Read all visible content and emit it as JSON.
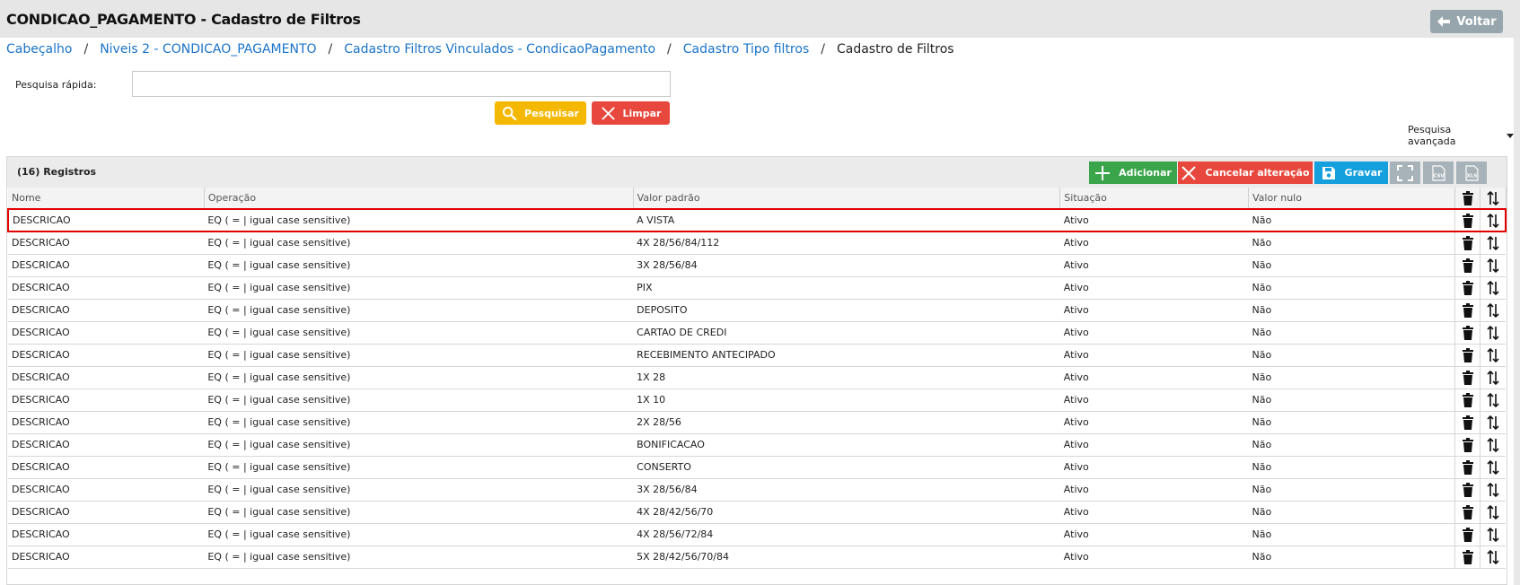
{
  "header": {
    "title": "CONDICAO_PAGAMENTO - Cadastro de Filtros",
    "back_label": "Voltar"
  },
  "breadcrumb": {
    "items": [
      "Cabeçalho",
      "Niveis 2 - CONDICAO_PAGAMENTO",
      "Cadastro Filtros Vinculados - CondicaoPagamento",
      "Cadastro Tipo filtros"
    ],
    "current": "Cadastro de Filtros",
    "separator": "/"
  },
  "search": {
    "label": "Pesquisa rápida:",
    "value": "",
    "search_label": "Pesquisar",
    "clear_label": "Limpar",
    "advanced_label": "Pesquisa avançada"
  },
  "panel": {
    "count_label": "(16) Registros",
    "add_label": "Adicionar",
    "cancel_label": "Cancelar alteração",
    "save_label": "Gravar",
    "csv_label": "CSV",
    "xls_label": "XLS"
  },
  "table": {
    "columns": [
      "Nome",
      "Operação",
      "Valor padrão",
      "Situação",
      "Valor nulo"
    ],
    "rows": [
      [
        "DESCRICAO",
        "EQ ( = | igual case sensitive)",
        "A VISTA",
        "Ativo",
        "Não"
      ],
      [
        "DESCRICAO",
        "EQ ( = | igual case sensitive)",
        "4X 28/56/84/112",
        "Ativo",
        "Não"
      ],
      [
        "DESCRICAO",
        "EQ ( = | igual case sensitive)",
        "3X 28/56/84",
        "Ativo",
        "Não"
      ],
      [
        "DESCRICAO",
        "EQ ( = | igual case sensitive)",
        "PIX",
        "Ativo",
        "Não"
      ],
      [
        "DESCRICAO",
        "EQ ( = | igual case sensitive)",
        "DEPOSITO",
        "Ativo",
        "Não"
      ],
      [
        "DESCRICAO",
        "EQ ( = | igual case sensitive)",
        "CARTAO DE CREDI",
        "Ativo",
        "Não"
      ],
      [
        "DESCRICAO",
        "EQ ( = | igual case sensitive)",
        "RECEBIMENTO ANTECIPADO",
        "Ativo",
        "Não"
      ],
      [
        "DESCRICAO",
        "EQ ( = | igual case sensitive)",
        "1X 28",
        "Ativo",
        "Não"
      ],
      [
        "DESCRICAO",
        "EQ ( = | igual case sensitive)",
        "1X 10",
        "Ativo",
        "Não"
      ],
      [
        "DESCRICAO",
        "EQ ( = | igual case sensitive)",
        "2X 28/56",
        "Ativo",
        "Não"
      ],
      [
        "DESCRICAO",
        "EQ ( = | igual case sensitive)",
        "BONIFICACAO",
        "Ativo",
        "Não"
      ],
      [
        "DESCRICAO",
        "EQ ( = | igual case sensitive)",
        "CONSERTO",
        "Ativo",
        "Não"
      ],
      [
        "DESCRICAO",
        "EQ ( = | igual case sensitive)",
        "3X 28/56/84",
        "Ativo",
        "Não"
      ],
      [
        "DESCRICAO",
        "EQ ( = | igual case sensitive)",
        "4X 28/42/56/70",
        "Ativo",
        "Não"
      ],
      [
        "DESCRICAO",
        "EQ ( = | igual case sensitive)",
        "4X 28/56/72/84",
        "Ativo",
        "Não"
      ],
      [
        "DESCRICAO",
        "EQ ( = | igual case sensitive)",
        "5X 28/42/56/70/84",
        "Ativo",
        "Não"
      ]
    ]
  },
  "colors": {
    "link": "#1a73c9",
    "search_button": "#f5b800",
    "clear_button": "#e7473c",
    "add_button": "#3aa54a",
    "cancel_button": "#e7473c",
    "save_button": "#149fdd",
    "icon_button": "#a7b3b8",
    "back_button": "#97a6ad",
    "selection_outline": "#e30000"
  },
  "icons": {
    "back": "arrow-left-icon",
    "search": "magnifier-icon",
    "clear": "x-icon",
    "add": "plus-icon",
    "cancel": "x-icon",
    "save": "floppy-disk-icon",
    "fullscreen": "expand-icon",
    "csv": "csv-file-icon",
    "xls": "xls-file-icon",
    "delete": "trash-icon",
    "move": "sort-arrows-icon"
  },
  "selected_row": 0
}
